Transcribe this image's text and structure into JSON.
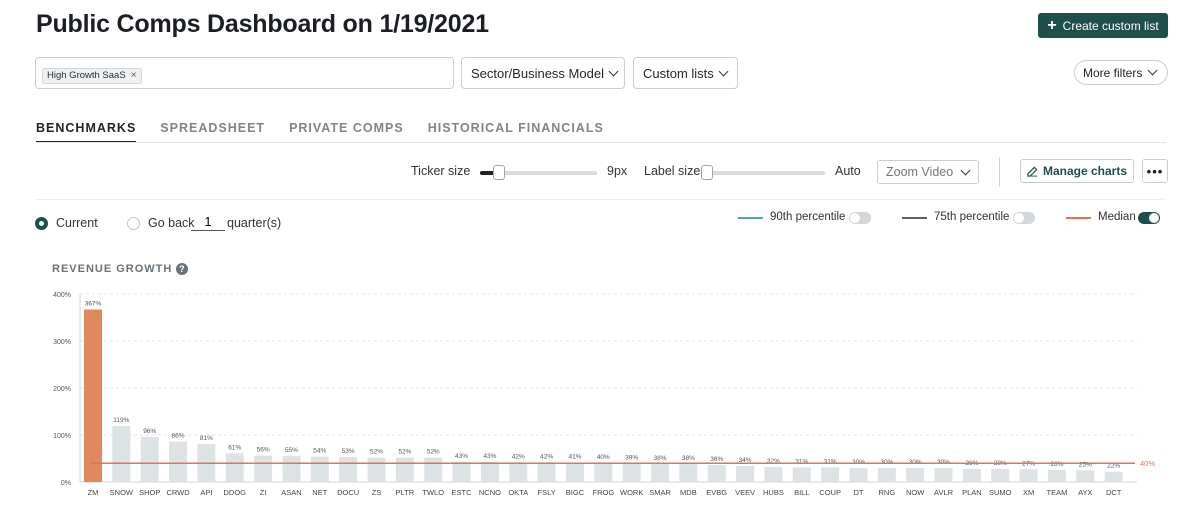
{
  "page": {
    "title": "Public Comps Dashboard on 1/19/2021"
  },
  "header": {
    "create_label": "Create custom list"
  },
  "filters": {
    "tags": [
      "High Growth SaaS"
    ],
    "sector_label": "Sector/Business Model",
    "custom_lists_label": "Custom lists",
    "more_filters_label": "More filters"
  },
  "tabs": [
    {
      "label": "BENCHMARKS",
      "active": true
    },
    {
      "label": "SPREADSHEET",
      "active": false
    },
    {
      "label": "PRIVATE COMPS",
      "active": false
    },
    {
      "label": "HISTORICAL FINANCIALS",
      "active": false
    }
  ],
  "controls": {
    "ticker_size_label": "Ticker size",
    "ticker_size_value": "9px",
    "ticker_size_fraction": 0.12,
    "label_size_label": "Label size",
    "label_size_value": "Auto",
    "label_size_fraction": 0.0,
    "zoom_label": "Zoom Video",
    "manage_charts_label": "Manage charts"
  },
  "period": {
    "current_label": "Current",
    "go_back_label": "Go back",
    "quarters_value": "1",
    "quarters_suffix": "quarter(s)",
    "selected": "current"
  },
  "legend": [
    {
      "label": "90th percentile",
      "color": "#4aa3c8",
      "enabled": false
    },
    {
      "label": "75th percentile",
      "color": "#5b6268",
      "enabled": false
    },
    {
      "label": "Median",
      "color": "#e0735a",
      "enabled": true
    }
  ],
  "chart_data": {
    "type": "bar",
    "title": "REVENUE GROWTH",
    "categories": [
      "ZM",
      "SNOW",
      "SHOP",
      "CRWD",
      "API",
      "DDOG",
      "ZI",
      "ASAN",
      "NET",
      "DOCU",
      "ZS",
      "PLTR",
      "TWLO",
      "ESTC",
      "NCNO",
      "OKTA",
      "FSLY",
      "BIGC",
      "FROG",
      "WORK",
      "SMAR",
      "MDB",
      "EVBG",
      "VEEV",
      "HUBS",
      "BILL",
      "COUP",
      "DT",
      "RNG",
      "NOW",
      "AVLR",
      "PLAN",
      "SUMO",
      "XM",
      "TEAM",
      "AYX",
      "DCT"
    ],
    "values": [
      367,
      119,
      96,
      86,
      81,
      61,
      56,
      55,
      54,
      53,
      52,
      52,
      52,
      43,
      43,
      42,
      42,
      41,
      40,
      39,
      38,
      38,
      36,
      34,
      32,
      31,
      31,
      30,
      30,
      30,
      30,
      28,
      28,
      27,
      26,
      25,
      22
    ],
    "yticks": [
      "0%",
      "100%",
      "200%",
      "300%",
      "400%"
    ],
    "ylim": [
      0,
      400
    ],
    "median": 40,
    "median_label": "40%",
    "highlight_color": "#e0895f",
    "bar_color": "#dde2e5",
    "median_color": "#e0735a",
    "grid": true
  }
}
